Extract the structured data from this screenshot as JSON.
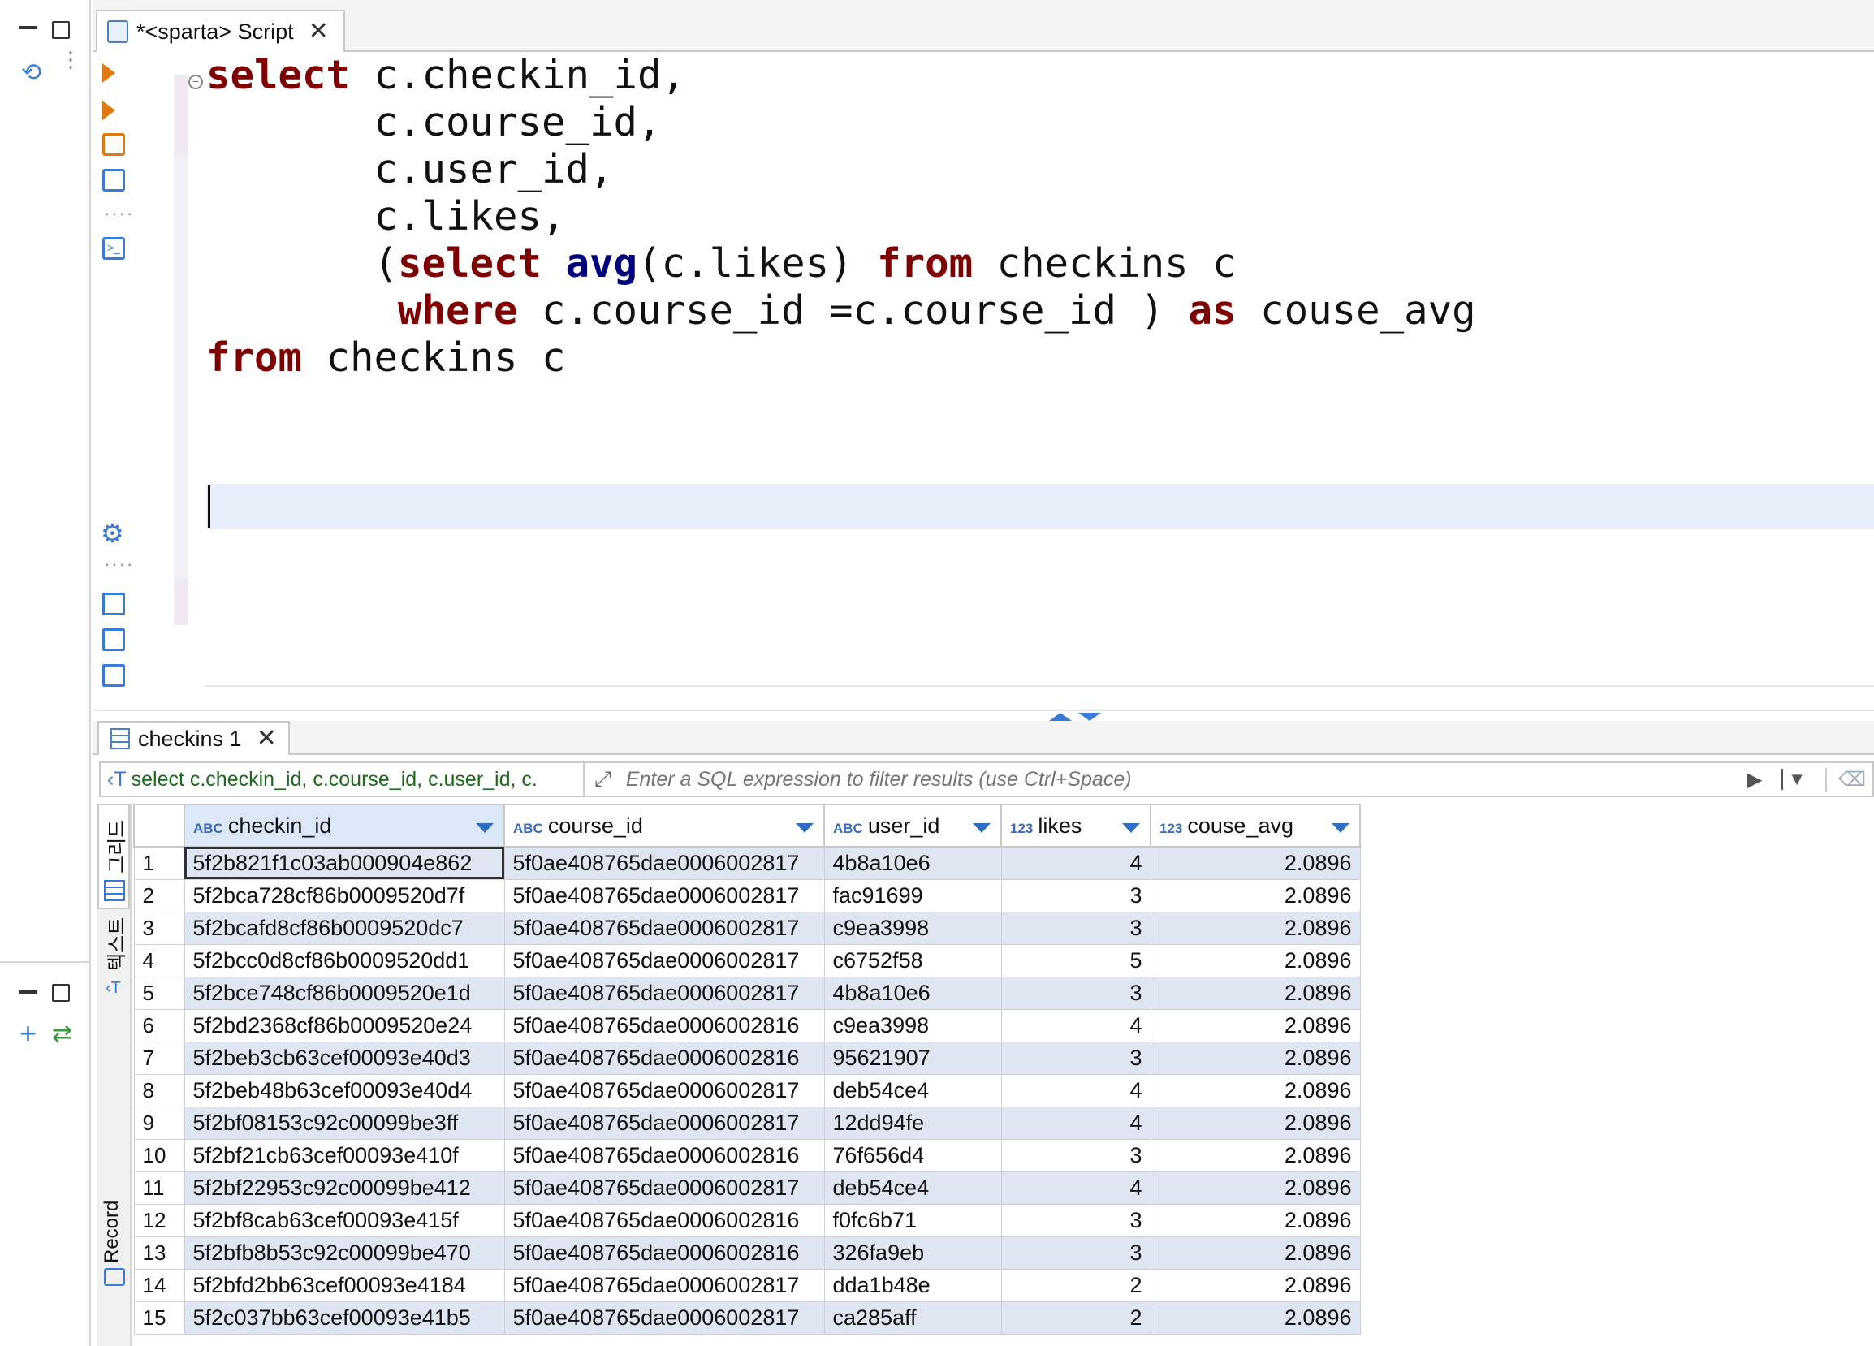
{
  "editor": {
    "tab_label": "*<sparta> Script",
    "code_lines": [
      [
        {
          "k": "select",
          "t": "kw"
        },
        {
          "k": " c.checkin_id,",
          "t": ""
        }
      ],
      [
        {
          "k": "       c.course_id,",
          "t": ""
        }
      ],
      [
        {
          "k": "       c.user_id,",
          "t": ""
        }
      ],
      [
        {
          "k": "       c.likes,",
          "t": ""
        }
      ],
      [
        {
          "k": "       (",
          "t": ""
        },
        {
          "k": "select",
          "t": "kw"
        },
        {
          "k": " ",
          "t": ""
        },
        {
          "k": "avg",
          "t": "fn"
        },
        {
          "k": "(c.likes) ",
          "t": ""
        },
        {
          "k": "from",
          "t": "kw"
        },
        {
          "k": " checkins c",
          "t": ""
        }
      ],
      [
        {
          "k": "        ",
          "t": ""
        },
        {
          "k": "where",
          "t": "kw"
        },
        {
          "k": " c.course_id =c.course_id ) ",
          "t": ""
        },
        {
          "k": "as",
          "t": "kw"
        },
        {
          "k": " couse_avg",
          "t": ""
        }
      ],
      [
        {
          "k": "from",
          "t": "kw"
        },
        {
          "k": " checkins c",
          "t": ""
        }
      ]
    ]
  },
  "results": {
    "tab_label": "checkins 1",
    "filter_query": "select c.checkin_id, c.course_id, c.user_id, c.",
    "filter_placeholder": "Enter a SQL expression to filter results (use Ctrl+Space)",
    "vtab_grid": "그리드",
    "vtab_text": "텍스트",
    "vtab_record": "Record",
    "columns": [
      {
        "type": "ABC",
        "name": "checkin_id"
      },
      {
        "type": "ABC",
        "name": "course_id"
      },
      {
        "type": "ABC",
        "name": "user_id"
      },
      {
        "type": "123",
        "name": "likes"
      },
      {
        "type": "123",
        "name": "couse_avg"
      }
    ],
    "rows": [
      [
        "1",
        "5f2b821f1c03ab000904e862",
        "5f0ae408765dae0006002817",
        "4b8a10e6",
        "4",
        "2.0896"
      ],
      [
        "2",
        "5f2bca728cf86b0009520d7f",
        "5f0ae408765dae0006002817",
        "fac91699",
        "3",
        "2.0896"
      ],
      [
        "3",
        "5f2bcafd8cf86b0009520dc7",
        "5f0ae408765dae0006002817",
        "c9ea3998",
        "3",
        "2.0896"
      ],
      [
        "4",
        "5f2bcc0d8cf86b0009520dd1",
        "5f0ae408765dae0006002817",
        "c6752f58",
        "5",
        "2.0896"
      ],
      [
        "5",
        "5f2bce748cf86b0009520e1d",
        "5f0ae408765dae0006002817",
        "4b8a10e6",
        "3",
        "2.0896"
      ],
      [
        "6",
        "5f2bd2368cf86b0009520e24",
        "5f0ae408765dae0006002816",
        "c9ea3998",
        "4",
        "2.0896"
      ],
      [
        "7",
        "5f2beb3cb63cef00093e40d3",
        "5f0ae408765dae0006002816",
        "95621907",
        "3",
        "2.0896"
      ],
      [
        "8",
        "5f2beb48b63cef00093e40d4",
        "5f0ae408765dae0006002817",
        "deb54ce4",
        "4",
        "2.0896"
      ],
      [
        "9",
        "5f2bf08153c92c00099be3ff",
        "5f0ae408765dae0006002817",
        "12dd94fe",
        "4",
        "2.0896"
      ],
      [
        "10",
        "5f2bf21cb63cef00093e410f",
        "5f0ae408765dae0006002816",
        "76f656d4",
        "3",
        "2.0896"
      ],
      [
        "11",
        "5f2bf22953c92c00099be412",
        "5f0ae408765dae0006002817",
        "deb54ce4",
        "4",
        "2.0896"
      ],
      [
        "12",
        "5f2bf8cab63cef00093e415f",
        "5f0ae408765dae0006002816",
        "f0fc6b71",
        "3",
        "2.0896"
      ],
      [
        "13",
        "5f2bfb8b53c92c00099be470",
        "5f0ae408765dae0006002816",
        "326fa9eb",
        "3",
        "2.0896"
      ],
      [
        "14",
        "5f2bfd2bb63cef00093e4184",
        "5f0ae408765dae0006002817",
        "dda1b48e",
        "2",
        "2.0896"
      ],
      [
        "15",
        "5f2c037bb63cef00093e41b5",
        "5f0ae408765dae0006002817",
        "ca285aff",
        "2",
        "2.0896"
      ]
    ]
  },
  "icons": [
    "minimize-icon",
    "maximize-icon",
    "sync-icon",
    "more-icon",
    "run-statement-icon",
    "run-new-tab-icon",
    "execute-script-icon",
    "explain-plan-icon",
    "terminal-icon",
    "settings-icon",
    "export-icon",
    "error-log-icon",
    "variables-icon",
    "grid-icon",
    "text-icon",
    "record-icon",
    "filter-icon",
    "eraser-icon",
    "add-icon",
    "link-icon",
    "collapse-icon",
    "expand-icon"
  ]
}
